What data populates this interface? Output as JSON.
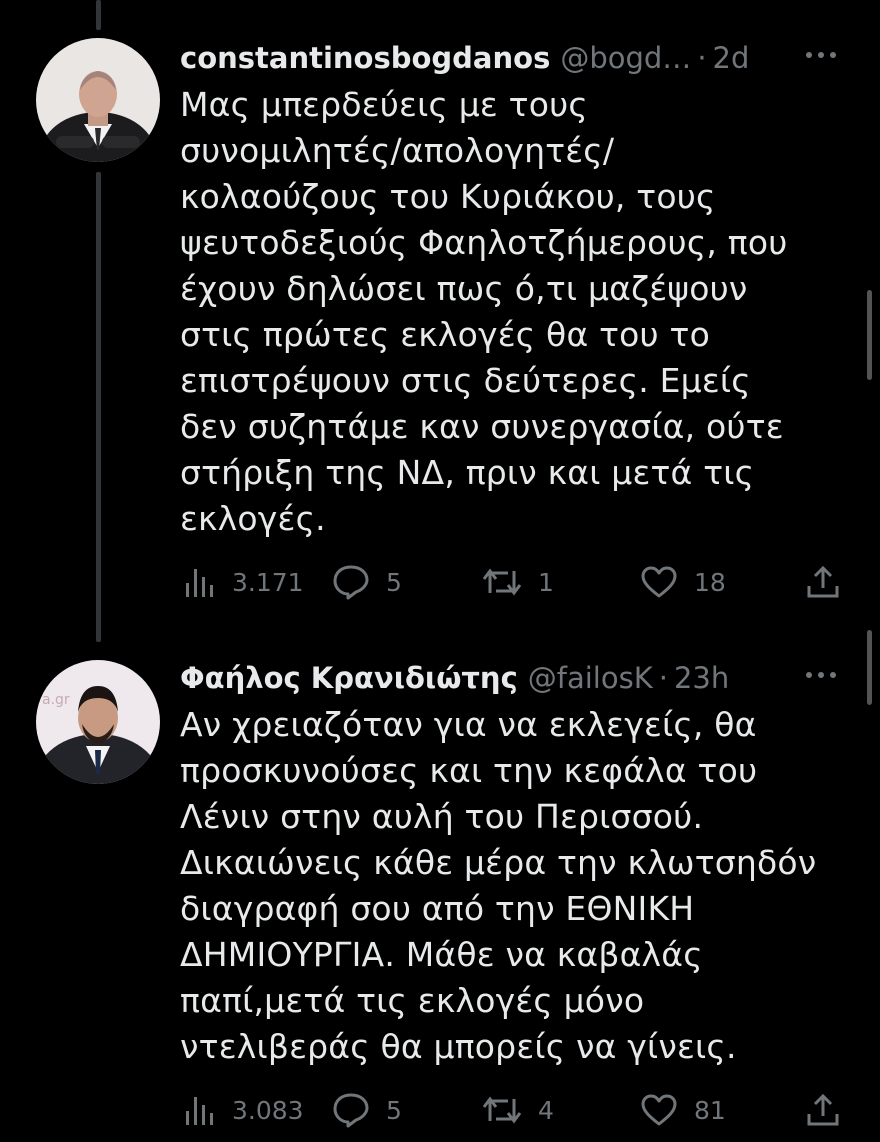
{
  "colors": {
    "background": "#000000",
    "text": "#e7e9ea",
    "muted": "#71767b",
    "thread_line": "#333639"
  },
  "tweets": [
    {
      "name": "constantinosbogdanos",
      "handle": "@bogd…",
      "separator": "·",
      "time": "2d",
      "more_icon": "more-horizontal-icon",
      "text_lines": [
        "Μας μπερδεύεις με τους",
        "συνομιλητές/απολογητές/",
        "κολαούζους του Κυριάκου, τους",
        "ψευτοδεξιούς Φαηλοτζήμερους, που",
        "έχουν δηλώσει πως ό,τι μαζέψουν",
        "στις πρώτες εκλογές θα του το",
        "επιστρέψουν στις δεύτερες. Εμείς",
        "δεν συζητάμε καν συνεργασία, ούτε",
        "στήριξη της ΝΔ, πριν και μετά τις",
        "εκλογές."
      ],
      "stats": {
        "views": "3.171",
        "replies": "5",
        "retweets": "1",
        "likes": "18"
      }
    },
    {
      "name": "Φαήλος Κρανιδιώτης",
      "handle": "@failosK",
      "separator": "·",
      "time": "23h",
      "more_icon": "more-horizontal-icon",
      "text_lines": [
        "Αν χρειαζόταν για να εκλεγείς, θα",
        "προσκυνούσες και την κεφάλα του",
        "Λένιν στην αυλή του Περισσού.",
        "Δικαιώνεις κάθε μέρα την κλωτσηδόν",
        "διαγραφή σου από την ΕΘΝΙΚΗ",
        "ΔΗΜΙΟΥΡΓΙΑ. Μάθε να καβαλάς",
        "παπί,μετά τις εκλογές μόνο",
        "ντελιβεράς θα μπορείς να γίνεις."
      ],
      "avatar_watermark": "a.gr",
      "stats": {
        "views": "3.083",
        "replies": "5",
        "retweets": "4",
        "likes": "81"
      }
    }
  ]
}
